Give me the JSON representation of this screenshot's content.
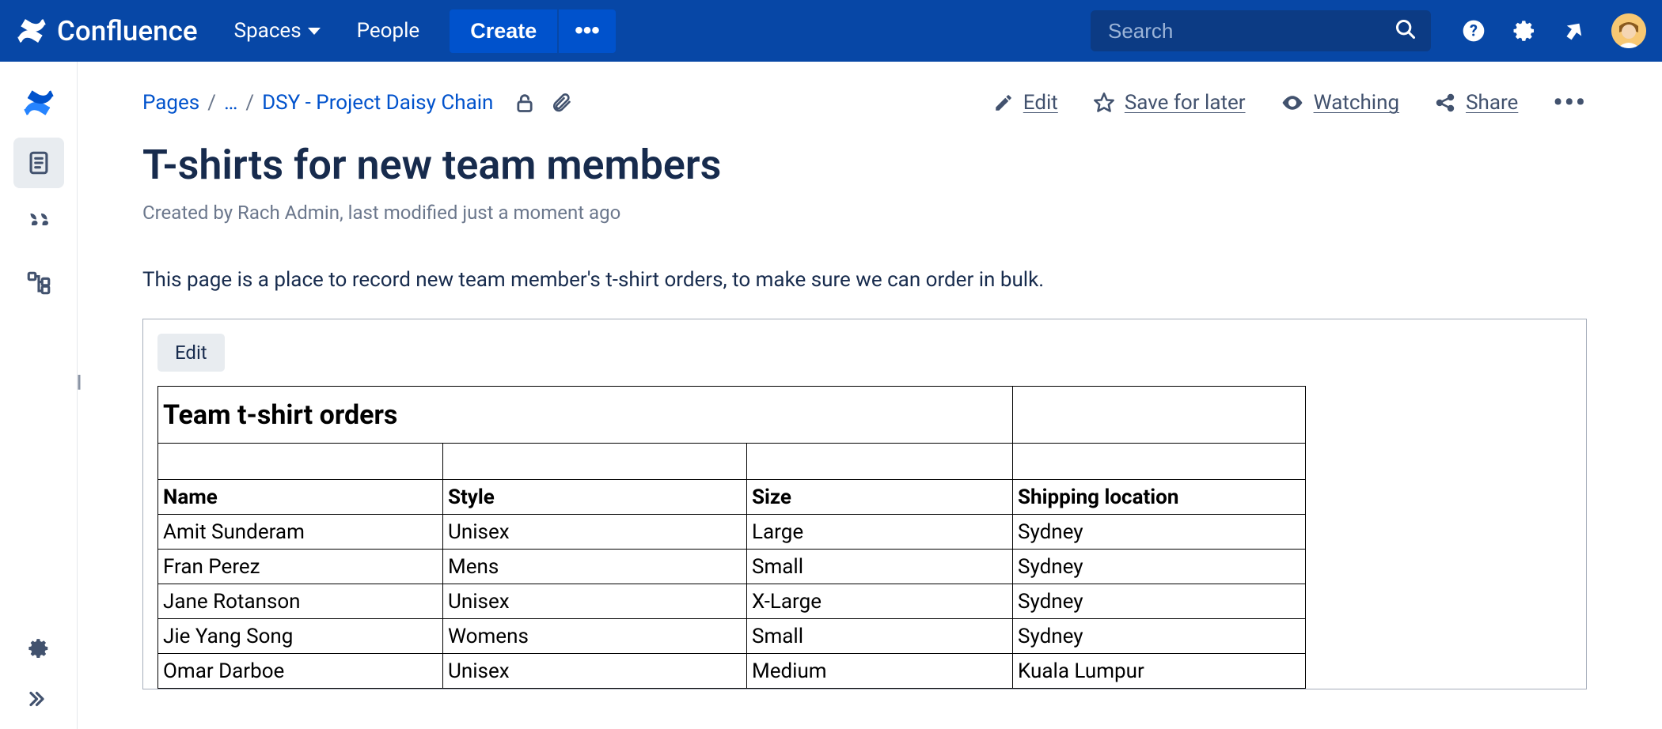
{
  "top": {
    "app_name": "Confluence",
    "spaces": "Spaces",
    "people": "People",
    "create": "Create",
    "more_dots": "•••",
    "search_placeholder": "Search"
  },
  "breadcrumbs": {
    "pages": "Pages",
    "ellipsis": "…",
    "parent": "DSY - Project Daisy Chain"
  },
  "actions": {
    "edit": "Edit",
    "save": "Save for later",
    "watching": "Watching",
    "share": "Share"
  },
  "page": {
    "title": "T-shirts for new team members",
    "byline": "Created by Rach Admin, last modified just a moment ago",
    "intro": "This page is a place to record new team member's t-shirt orders, to make sure we can order in bulk.",
    "embed_edit": "Edit",
    "table_title": "Team t-shirt orders"
  },
  "table": {
    "headers": {
      "name": "Name",
      "style": "Style",
      "size": "Size",
      "ship": "Shipping location"
    },
    "rows": [
      {
        "name": "Amit Sunderam",
        "style": "Unisex",
        "size": "Large",
        "ship": "Sydney"
      },
      {
        "name": "Fran Perez",
        "style": "Mens",
        "size": "Small",
        "ship": "Sydney"
      },
      {
        "name": "Jane Rotanson",
        "style": "Unisex",
        "size": "X-Large",
        "ship": "Sydney"
      },
      {
        "name": "Jie Yang Song",
        "style": "Womens",
        "size": "Small",
        "ship": "Sydney"
      },
      {
        "name": "Omar Darboe",
        "style": "Unisex",
        "size": "Medium",
        "ship": "Kuala Lumpur"
      }
    ]
  }
}
